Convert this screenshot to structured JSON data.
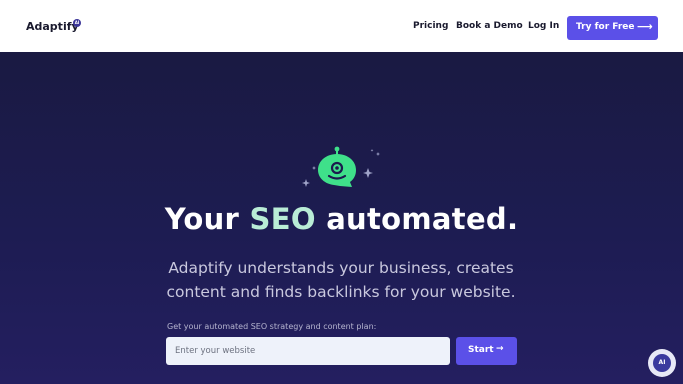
{
  "nav": {
    "logo": "Adaptify",
    "logo_badge": "AI",
    "links": [
      "Pricing",
      "Book a Demo",
      "Log In"
    ],
    "cta": "Try for Free",
    "cta_icon": "arrow-right-icon"
  },
  "hero": {
    "headline_before": "Your",
    "headline_accent": "SEO",
    "headline_after": "automated.",
    "subline": "Adaptify understands your business, creates content and finds backlinks for your website.",
    "mascot_icon": "robot-chat-icon"
  },
  "form": {
    "label": "Get your automated SEO strategy and content plan:",
    "placeholder": "Enter your website",
    "button": "Start",
    "button_icon": "arrow-right-icon"
  },
  "chat": {
    "label": "AI",
    "icon": "chat-assistant-icon"
  },
  "colors": {
    "brand": "#5b50e8",
    "hero_bg": "#1b1a4d",
    "accent_text": "#b9ecd6",
    "mascot": "#3fe08a"
  }
}
